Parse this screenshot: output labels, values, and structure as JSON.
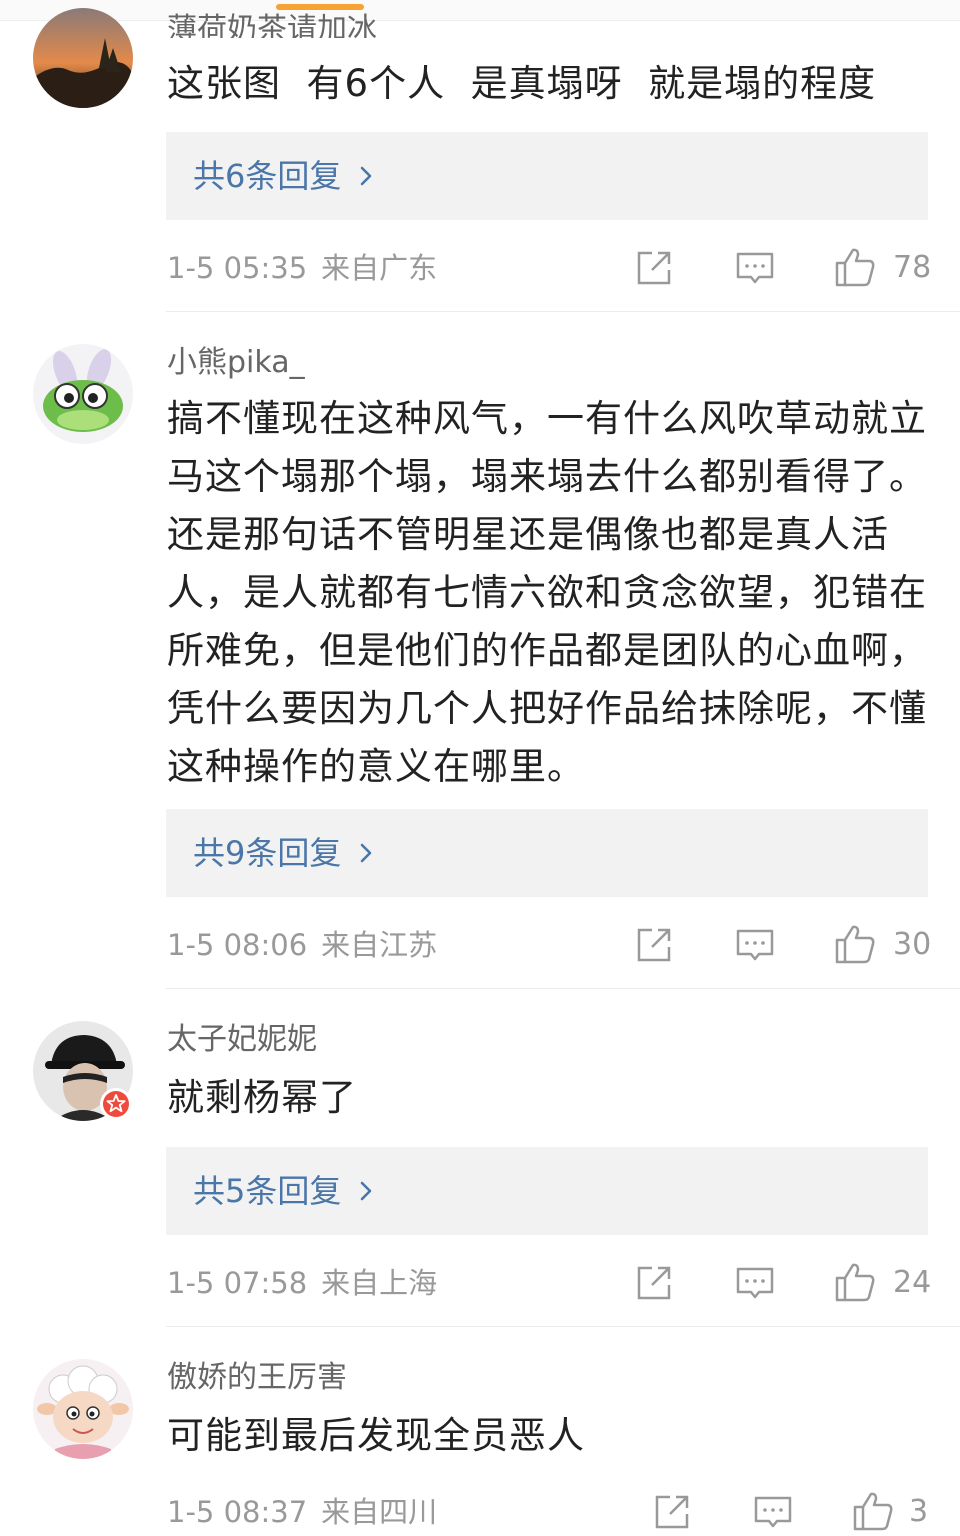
{
  "comments": [
    {
      "username": "薄荷奶茶请加冰",
      "text": "这张图  有6个人  是真塌呀  就是塌的程度",
      "reply_label": "共6条回复",
      "time": "1-5 05:35",
      "source": "来自广东",
      "likes": "78",
      "avatar_icon": "sunset-avatar-icon"
    },
    {
      "username": "小熊pika_",
      "text": "搞不懂现在这种风气，一有什么风吹草动就立马这个塌那个塌，塌来塌去什么都别看得了。还是那句话不管明星还是偶像也都是真人活人，是人就都有七情六欲和贪念欲望，犯错在所难免，但是他们的作品都是团队的心血啊，凭什么要因为几个人把好作品给抹除呢，不懂这种操作的意义在哪里。",
      "reply_label": "共9条回复",
      "time": "1-5 08:06",
      "source": "来自江苏",
      "likes": "30",
      "avatar_icon": "frog-avatar-icon"
    },
    {
      "username": "太子妃妮妮",
      "text": "就剩杨幂了",
      "reply_label": "共5条回复",
      "time": "1-5 07:58",
      "source": "来自上海",
      "likes": "24",
      "avatar_icon": "person-avatar-icon"
    },
    {
      "username": "傲娇的王厉害",
      "text": "可能到最后发现全员恶人",
      "time": "1-5 08:37",
      "source": "来自四川",
      "likes": "3",
      "avatar_icon": "sheep-avatar-icon"
    }
  ],
  "icons": {
    "share": "share-icon",
    "comment": "comment-icon",
    "like": "thumbs-up-icon",
    "chevron": "chevron-right-icon"
  },
  "colors": {
    "accent_tab": "#f7a233",
    "reply_link": "#4a76a8",
    "reply_bg": "#f2f2f2",
    "meta_text": "#999999"
  }
}
